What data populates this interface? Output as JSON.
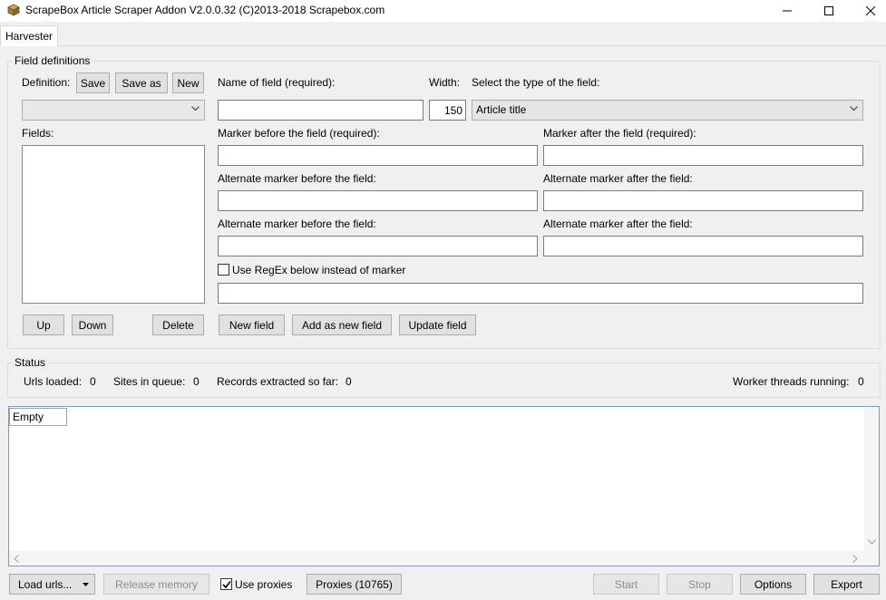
{
  "window": {
    "title": "ScrapeBox Article Scraper Addon V2.0.0.32 (C)2013-2018 Scrapebox.com"
  },
  "tabs": [
    {
      "label": "Harvester"
    }
  ],
  "field_definitions": {
    "group_title": "Field definitions",
    "definition_label": "Definition:",
    "save_label": "Save",
    "save_as_label": "Save as",
    "new_label": "New",
    "definition_value": "",
    "fields_label": "Fields:",
    "up_label": "Up",
    "down_label": "Down",
    "delete_label": "Delete",
    "name_label": "Name of field (required):",
    "name_value": "",
    "width_label": "Width:",
    "width_value": "150",
    "type_label": "Select the type of the field:",
    "type_value": "Article title",
    "marker_before_label": "Marker before the field (required):",
    "marker_before_value": "",
    "marker_after_label": "Marker after the field (required):",
    "marker_after_value": "",
    "alt_before_1_label": "Alternate marker before the field:",
    "alt_before_1_value": "",
    "alt_after_1_label": "Alternate marker after the field:",
    "alt_after_1_value": "",
    "alt_before_2_label": "Alternate marker before the field:",
    "alt_before_2_value": "",
    "alt_after_2_label": "Alternate marker after the field:",
    "alt_after_2_value": "",
    "regex_label": "Use RegEx below instead of marker",
    "regex_checked": false,
    "regex_value": "",
    "new_field_label": "New field",
    "add_new_field_label": "Add as new field",
    "update_field_label": "Update field"
  },
  "status": {
    "group_title": "Status",
    "urls_loaded_label": "Urls loaded:",
    "urls_loaded_value": "0",
    "sites_queue_label": "Sites in queue:",
    "sites_queue_value": "0",
    "records_label": "Records extracted so far:",
    "records_value": "0",
    "threads_label": "Worker threads running:",
    "threads_value": "0"
  },
  "output": {
    "column_header": "Empty"
  },
  "bottom_bar": {
    "load_urls_label": "Load urls...",
    "release_memory_label": "Release memory",
    "use_proxies_label": "Use proxies",
    "use_proxies_checked": true,
    "proxies_label": "Proxies (10765)",
    "start_label": "Start",
    "stop_label": "Stop",
    "options_label": "Options",
    "export_label": "Export"
  },
  "colors": {
    "accent_border": "#7a9cc4",
    "button_face": "#e1e1e1",
    "window_bg": "#f0f0f0"
  }
}
